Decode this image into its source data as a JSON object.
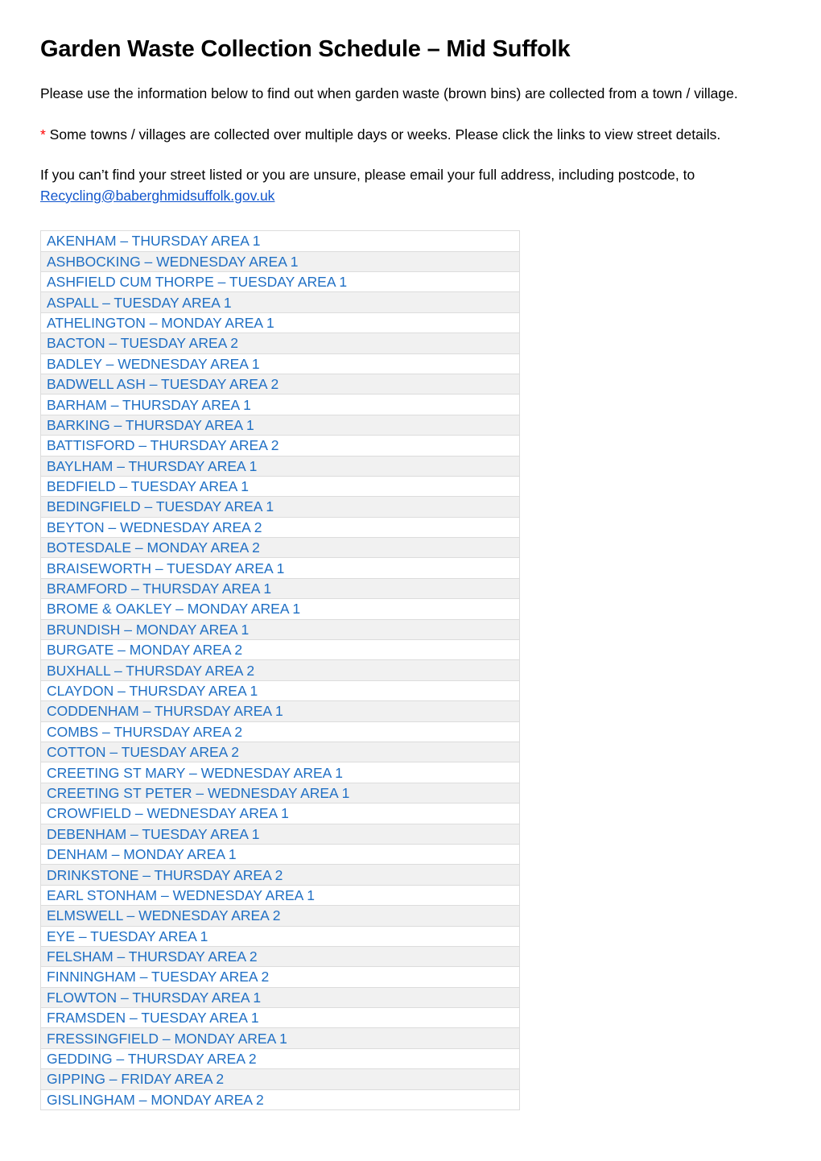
{
  "document": {
    "title": "Garden Waste Collection Schedule – Mid Suffolk",
    "paragraphs": {
      "intro": "Please use the information below to find out when garden waste (brown bins) are collected from a town / village.",
      "note_marker": "*",
      "note": " Some towns / villages are collected over multiple days or weeks. Please click the links to view street details.",
      "contact_prefix": "If you can’t find your street listed or you are unsure, please email your full address, including postcode, to ",
      "contact_email": "Recycling@baberghmidsuffolk.gov.uk"
    },
    "colors": {
      "link_blue": "#1f6fc4",
      "email_blue": "#1155cc",
      "asterisk_red": "#ff0000",
      "row_stripe": "#f1f1f1",
      "row_border": "#dcdcdc"
    }
  },
  "schedule": {
    "rows": [
      {
        "label": "AKENHAM – THURSDAY AREA 1"
      },
      {
        "label": "ASHBOCKING – WEDNESDAY AREA 1"
      },
      {
        "label": "ASHFIELD CUM THORPE – TUESDAY AREA 1"
      },
      {
        "label": "ASPALL – TUESDAY AREA 1"
      },
      {
        "label": "ATHELINGTON – MONDAY AREA 1"
      },
      {
        "label": "BACTON – TUESDAY AREA 2"
      },
      {
        "label": "BADLEY – WEDNESDAY AREA 1"
      },
      {
        "label": "BADWELL ASH – TUESDAY AREA 2"
      },
      {
        "label": "BARHAM – THURSDAY AREA 1"
      },
      {
        "label": "BARKING – THURSDAY AREA 1"
      },
      {
        "label": "BATTISFORD – THURSDAY AREA 2"
      },
      {
        "label": "BAYLHAM – THURSDAY AREA 1"
      },
      {
        "label": "BEDFIELD – TUESDAY AREA 1"
      },
      {
        "label": "BEDINGFIELD – TUESDAY AREA 1"
      },
      {
        "label": "BEYTON – WEDNESDAY AREA 2"
      },
      {
        "label": "BOTESDALE – MONDAY AREA 2"
      },
      {
        "label": "BRAISEWORTH – TUESDAY AREA 1"
      },
      {
        "label": "BRAMFORD – THURSDAY AREA 1"
      },
      {
        "label": "BROME & OAKLEY – MONDAY AREA 1"
      },
      {
        "label": "BRUNDISH – MONDAY AREA 1"
      },
      {
        "label": "BURGATE – MONDAY AREA 2"
      },
      {
        "label": "BUXHALL – THURSDAY AREA 2"
      },
      {
        "label": "CLAYDON – THURSDAY AREA 1"
      },
      {
        "label": "CODDENHAM – THURSDAY AREA 1"
      },
      {
        "label": "COMBS – THURSDAY AREA 2"
      },
      {
        "label": "COTTON – TUESDAY AREA 2"
      },
      {
        "label": "CREETING ST MARY – WEDNESDAY AREA 1"
      },
      {
        "label": "CREETING ST PETER – WEDNESDAY AREA 1"
      },
      {
        "label": "CROWFIELD – WEDNESDAY AREA 1"
      },
      {
        "label": "DEBENHAM – TUESDAY AREA 1"
      },
      {
        "label": "DENHAM – MONDAY AREA 1"
      },
      {
        "label": "DRINKSTONE – THURSDAY AREA 2"
      },
      {
        "label": "EARL STONHAM – WEDNESDAY AREA 1"
      },
      {
        "label": "ELMSWELL – WEDNESDAY AREA 2"
      },
      {
        "label": "EYE – TUESDAY AREA 1"
      },
      {
        "label": "FELSHAM – THURSDAY AREA 2"
      },
      {
        "label": "FINNINGHAM – TUESDAY AREA 2"
      },
      {
        "label": "FLOWTON – THURSDAY AREA 1"
      },
      {
        "label": "FRAMSDEN – TUESDAY AREA 1"
      },
      {
        "label": "FRESSINGFIELD – MONDAY AREA 1"
      },
      {
        "label": "GEDDING – THURSDAY AREA 2"
      },
      {
        "label": "GIPPING – FRIDAY AREA 2"
      },
      {
        "label": "GISLINGHAM – MONDAY AREA 2"
      }
    ]
  }
}
